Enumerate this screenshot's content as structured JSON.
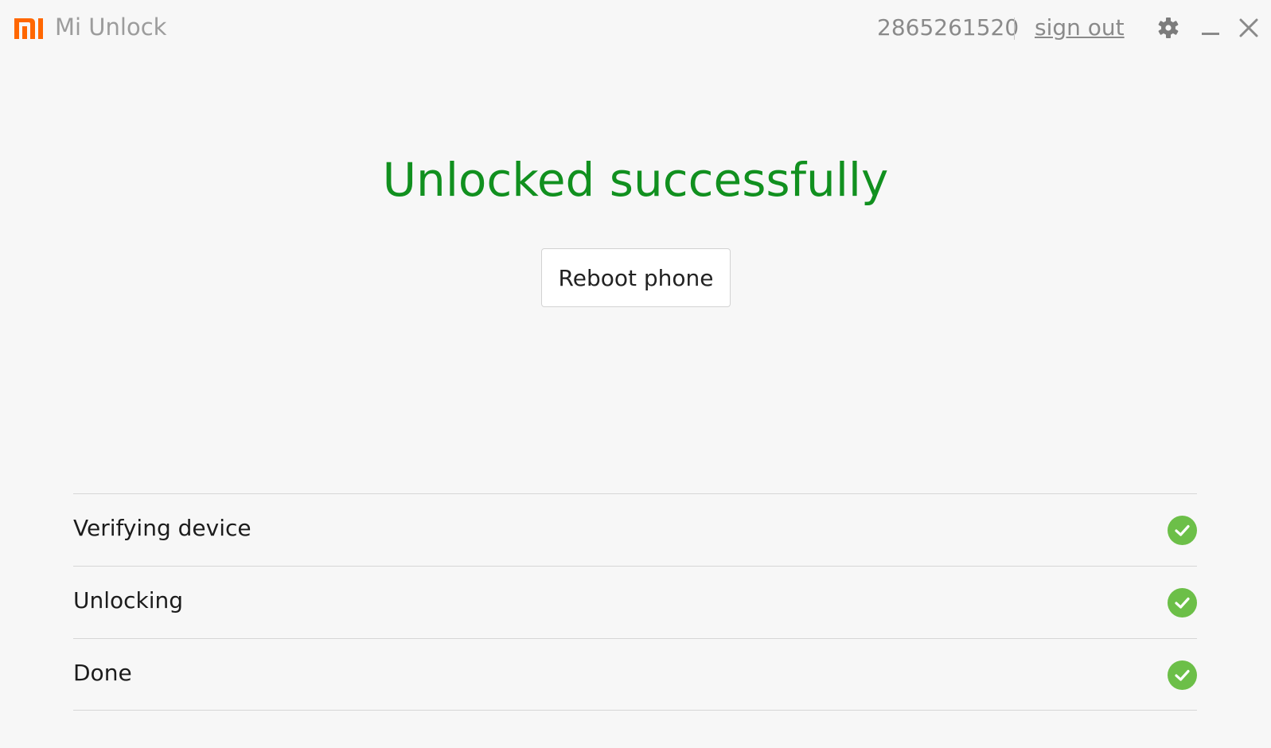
{
  "window": {
    "title": "Mi Unlock",
    "logo_icon": "mi-logo-icon",
    "account_id": "2865261520",
    "sign_out_label": "sign out",
    "controls": [
      "settings-gear-icon",
      "minimize-icon",
      "close-icon"
    ]
  },
  "main": {
    "headline": "Unlocked successfully",
    "reboot_button_label": "Reboot phone"
  },
  "steps": [
    {
      "label": "Verifying device",
      "status": "complete",
      "icon": "check-circle-icon"
    },
    {
      "label": "Unlocking",
      "status": "complete",
      "icon": "check-circle-icon"
    },
    {
      "label": "Done",
      "status": "complete",
      "icon": "check-circle-icon"
    }
  ],
  "colors": {
    "brand_orange": "#ff6700",
    "success_green": "#11901f",
    "check_green": "#6cbf48",
    "background": "#f7f7f7"
  }
}
